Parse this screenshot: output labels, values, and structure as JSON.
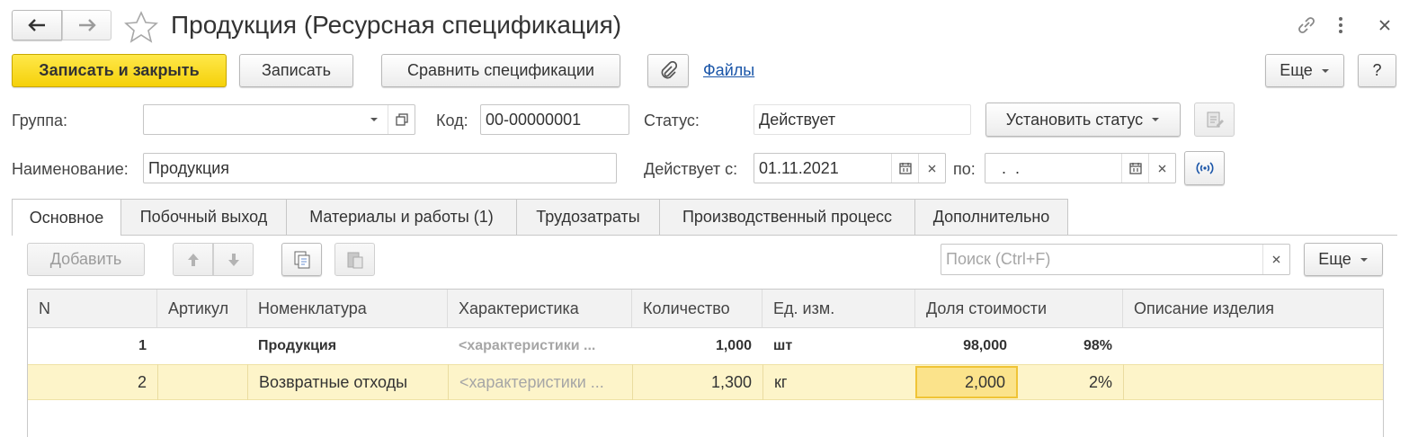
{
  "window": {
    "title": "Продукция (Ресурсная спецификация)"
  },
  "toolbar": {
    "save_close": "Записать и закрыть",
    "save": "Записать",
    "compare": "Сравнить спецификации",
    "files": "Файлы",
    "more": "Еще",
    "help": "?"
  },
  "form": {
    "group_label": "Группа:",
    "group_value": "",
    "code_label": "Код:",
    "code_value": "00-00000001",
    "status_label": "Статус:",
    "status_value": "Действует",
    "set_status": "Установить статус",
    "name_label": "Наименование:",
    "name_value": "Продукция",
    "valid_from_label": "Действует с:",
    "valid_from_value": "01.11.2021",
    "valid_to_label": "по:",
    "valid_to_value": " .  ."
  },
  "tabs": [
    {
      "label": "Основное"
    },
    {
      "label": "Побочный выход"
    },
    {
      "label": "Материалы и работы (1)"
    },
    {
      "label": "Трудозатраты"
    },
    {
      "label": "Производственный процесс"
    },
    {
      "label": "Дополнительно"
    }
  ],
  "table_toolbar": {
    "add": "Добавить",
    "search_placeholder": "Поиск (Ctrl+F)",
    "more": "Еще"
  },
  "table": {
    "columns": [
      "N",
      "Артикул",
      "Номенклатура",
      "Характеристика",
      "Количество",
      "Ед. изм.",
      "Доля стоимости",
      "Описание изделия"
    ],
    "rows": [
      {
        "n": "1",
        "article": "",
        "item": "Продукция",
        "characteristic": "<характеристики ...",
        "qty": "1,000",
        "unit": "шт",
        "cost_share": "98,000",
        "percent": "98%",
        "description": ""
      },
      {
        "n": "2",
        "article": "",
        "item": "Возвратные отходы",
        "characteristic": "<характеристики ...",
        "qty": "1,300",
        "unit": "кг",
        "cost_share": "2,000",
        "percent": "2%",
        "description": ""
      }
    ]
  },
  "colors": {
    "primary_button": "#f5d10a",
    "selected_row": "#fdf4c9",
    "active_cell": "#fbe38b",
    "link": "#1a55a8"
  }
}
